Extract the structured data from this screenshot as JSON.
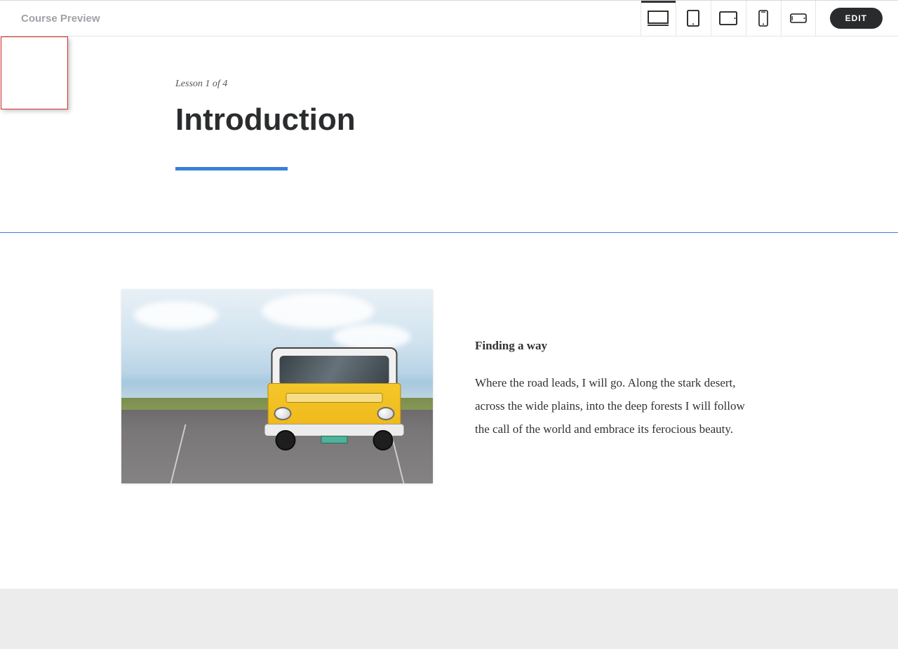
{
  "toolbar": {
    "title": "Course Preview",
    "edit": "EDIT"
  },
  "lesson": {
    "counter": "Lesson 1 of 4",
    "title": "Introduction"
  },
  "content": {
    "heading": "Finding a way",
    "body": "Where the road leads, I will go. Along the stark desert, across the wide plains, into the deep forests I will follow the call of the world and embrace its ferocious beauty."
  }
}
